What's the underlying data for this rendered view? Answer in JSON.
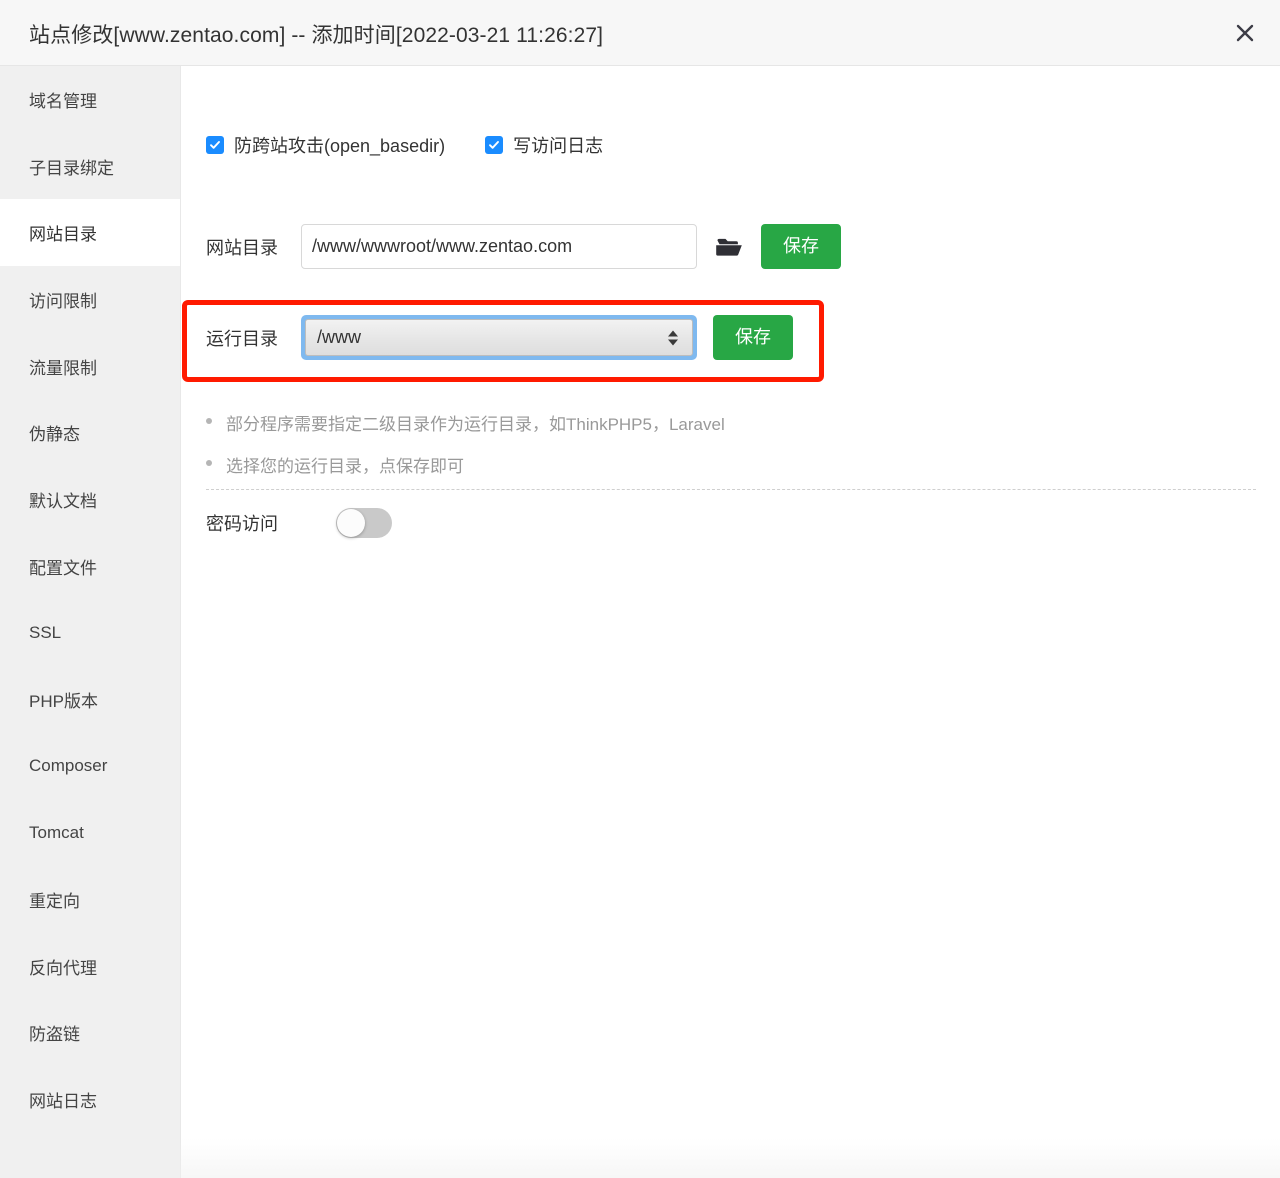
{
  "header": {
    "title": "站点修改[www.zentao.com] -- 添加时间[2022-03-21 11:26:27]",
    "close_icon": "close-icon"
  },
  "sidebar": {
    "active_index": 2,
    "items": [
      {
        "label": "域名管理"
      },
      {
        "label": "子目录绑定"
      },
      {
        "label": "网站目录"
      },
      {
        "label": "访问限制"
      },
      {
        "label": "流量限制"
      },
      {
        "label": "伪静态"
      },
      {
        "label": "默认文档"
      },
      {
        "label": "配置文件"
      },
      {
        "label": "SSL"
      },
      {
        "label": "PHP版本"
      },
      {
        "label": "Composer"
      },
      {
        "label": "Tomcat"
      },
      {
        "label": "重定向"
      },
      {
        "label": "反向代理"
      },
      {
        "label": "防盗链"
      },
      {
        "label": "网站日志"
      }
    ]
  },
  "main": {
    "checkboxes": [
      {
        "label": "防跨站攻击(open_basedir)",
        "checked": true
      },
      {
        "label": "写访问日志",
        "checked": true
      }
    ],
    "website_dir": {
      "label": "网站目录",
      "value": "/www/wwwroot/www.zentao.com",
      "placeholder": "请输入网站目录",
      "folder_icon": "folder-open-icon",
      "save_label": "保存"
    },
    "run_dir": {
      "label": "运行目录",
      "value": "/www",
      "save_label": "保存",
      "highlighted": true,
      "highlight_color": "#ff1a00"
    },
    "hints": [
      "部分程序需要指定二级目录作为运行目录，如ThinkPHP5，Laravel",
      "选择您的运行目录，点保存即可"
    ],
    "password_access": {
      "label": "密码访问",
      "enabled": false
    }
  },
  "colors": {
    "accent_green": "#28a745",
    "accent_blue": "#1a8cff",
    "highlight_red": "#ff1a00",
    "sidebar_bg": "#f0f0f0",
    "header_bg": "#f7f7f7"
  }
}
